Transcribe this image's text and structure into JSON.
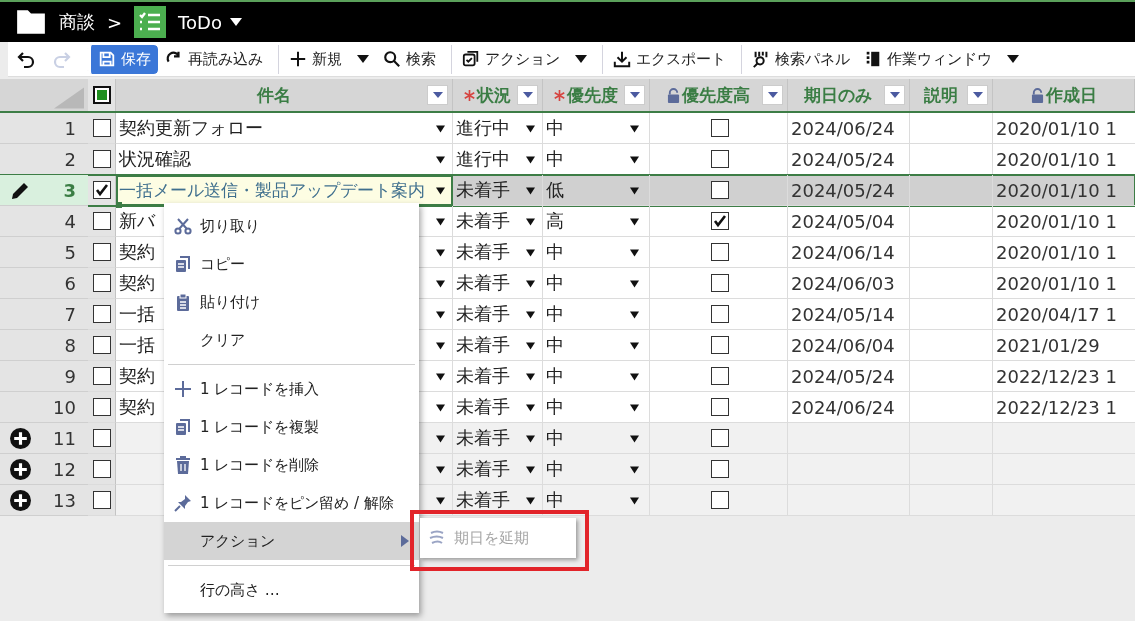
{
  "header": {
    "folder": "商談",
    "separator": ">",
    "view": "ToDo"
  },
  "toolbar": [
    {
      "kind": "undo",
      "disabled": false
    },
    {
      "kind": "redo",
      "disabled": true
    },
    {
      "kind": "save",
      "label": "保存",
      "primary": true,
      "dropdown": false,
      "sep": true
    },
    {
      "kind": "reload",
      "label": "再読み込み",
      "primary": false,
      "dropdown": false,
      "sep": false
    },
    {
      "kind": "new",
      "label": "新規",
      "primary": false,
      "dropdown": true,
      "sep": true
    },
    {
      "kind": "search",
      "label": "検索",
      "primary": false,
      "dropdown": false,
      "sep": false
    },
    {
      "kind": "action",
      "label": "アクション",
      "primary": false,
      "dropdown": true,
      "sep": true
    },
    {
      "kind": "export",
      "label": "エクスポート",
      "primary": false,
      "dropdown": false,
      "sep": true
    },
    {
      "kind": "panel",
      "label": "検索パネル",
      "primary": false,
      "dropdown": false,
      "sep": true
    },
    {
      "kind": "window",
      "label": "作業ウィンドウ",
      "primary": false,
      "dropdown": true,
      "sep": false
    }
  ],
  "columns": [
    {
      "label": "件名",
      "required": false,
      "locked": false,
      "filter": true
    },
    {
      "label": "状況",
      "required": true,
      "locked": false,
      "filter": true
    },
    {
      "label": "優先度",
      "required": true,
      "locked": false,
      "filter": true
    },
    {
      "label": "優先度高",
      "required": false,
      "locked": true,
      "filter": true
    },
    {
      "label": "期日のみ",
      "required": false,
      "locked": false,
      "filter": true
    },
    {
      "label": "説明",
      "required": false,
      "locked": false,
      "filter": true
    },
    {
      "label": "作成日",
      "required": false,
      "locked": true,
      "filter": false
    }
  ],
  "header_checkbox": {
    "checked": true
  },
  "rows": [
    {
      "number": "1",
      "checked": false,
      "editing": false,
      "new": false,
      "subject": "契約更新フォロー",
      "status": "進行中",
      "priority": "中",
      "high": false,
      "due": "2024/06/24",
      "created": "2020/01/10 1"
    },
    {
      "number": "2",
      "checked": false,
      "editing": false,
      "new": false,
      "subject": "状況確認",
      "status": "進行中",
      "priority": "中",
      "high": false,
      "due": "2024/05/24",
      "created": "2020/01/10 1"
    },
    {
      "number": "3",
      "checked": true,
      "editing": true,
      "new": false,
      "subject": "一括メール送信・製品アップデート案内",
      "status": "未着手",
      "priority": "低",
      "high": false,
      "due": "2024/05/24",
      "created": "2020/01/10 1"
    },
    {
      "number": "4",
      "checked": false,
      "editing": false,
      "new": false,
      "subject": "新バ",
      "status": "未着手",
      "priority": "高",
      "high": true,
      "due": "2024/05/04",
      "created": "2020/01/10 1"
    },
    {
      "number": "5",
      "checked": false,
      "editing": false,
      "new": false,
      "subject": "契約",
      "status": "未着手",
      "priority": "中",
      "high": false,
      "due": "2024/06/14",
      "created": "2020/01/10 1"
    },
    {
      "number": "6",
      "checked": false,
      "editing": false,
      "new": false,
      "subject": "契約",
      "status": "未着手",
      "priority": "中",
      "high": false,
      "due": "2024/06/03",
      "created": "2020/01/10 1"
    },
    {
      "number": "7",
      "checked": false,
      "editing": false,
      "new": false,
      "subject": "一括",
      "status": "未着手",
      "priority": "中",
      "high": false,
      "due": "2024/05/14",
      "created": "2020/04/17 1"
    },
    {
      "number": "8",
      "checked": false,
      "editing": false,
      "new": false,
      "subject": "一括",
      "status": "未着手",
      "priority": "中",
      "high": false,
      "due": "2024/06/04",
      "created": "2021/01/29"
    },
    {
      "number": "9",
      "checked": false,
      "editing": false,
      "new": false,
      "subject": "契約",
      "status": "未着手",
      "priority": "中",
      "high": false,
      "due": "2024/05/24",
      "created": "2022/12/23 1"
    },
    {
      "number": "10",
      "checked": false,
      "editing": false,
      "new": false,
      "subject": "契約",
      "status": "未着手",
      "priority": "中",
      "high": false,
      "due": "2024/06/24",
      "created": "2022/12/23 1"
    },
    {
      "number": "11",
      "checked": false,
      "editing": false,
      "new": true,
      "status": "未着手",
      "priority": "中",
      "high": false
    },
    {
      "number": "12",
      "checked": false,
      "editing": false,
      "new": true,
      "status": "未着手",
      "priority": "中",
      "high": false
    },
    {
      "number": "13",
      "checked": false,
      "editing": false,
      "new": true,
      "status": "未着手",
      "priority": "中",
      "high": false
    }
  ],
  "context_menu": {
    "groups": [
      [
        {
          "kind": "cut",
          "label": "切り取り",
          "selected": false
        },
        {
          "kind": "copy",
          "label": "コピー",
          "selected": false
        },
        {
          "kind": "paste",
          "label": "貼り付け",
          "selected": false
        },
        {
          "kind": "plain",
          "label": "クリア",
          "selected": false
        }
      ],
      [
        {
          "kind": "insert",
          "label": "1 レコードを挿入",
          "selected": false
        },
        {
          "kind": "duplicate",
          "label": "1 レコードを複製",
          "selected": false
        },
        {
          "kind": "delete",
          "label": "1 レコードを削除",
          "selected": false
        },
        {
          "kind": "pin",
          "label": "1 レコードをピン留め / 解除",
          "selected": false
        },
        {
          "kind": "submenu",
          "label": "アクション",
          "selected": true
        }
      ],
      [
        {
          "kind": "plain",
          "label": "行の高さ …",
          "selected": false
        }
      ]
    ]
  },
  "submenu": {
    "label": "期日を延期",
    "disabled": true
  }
}
